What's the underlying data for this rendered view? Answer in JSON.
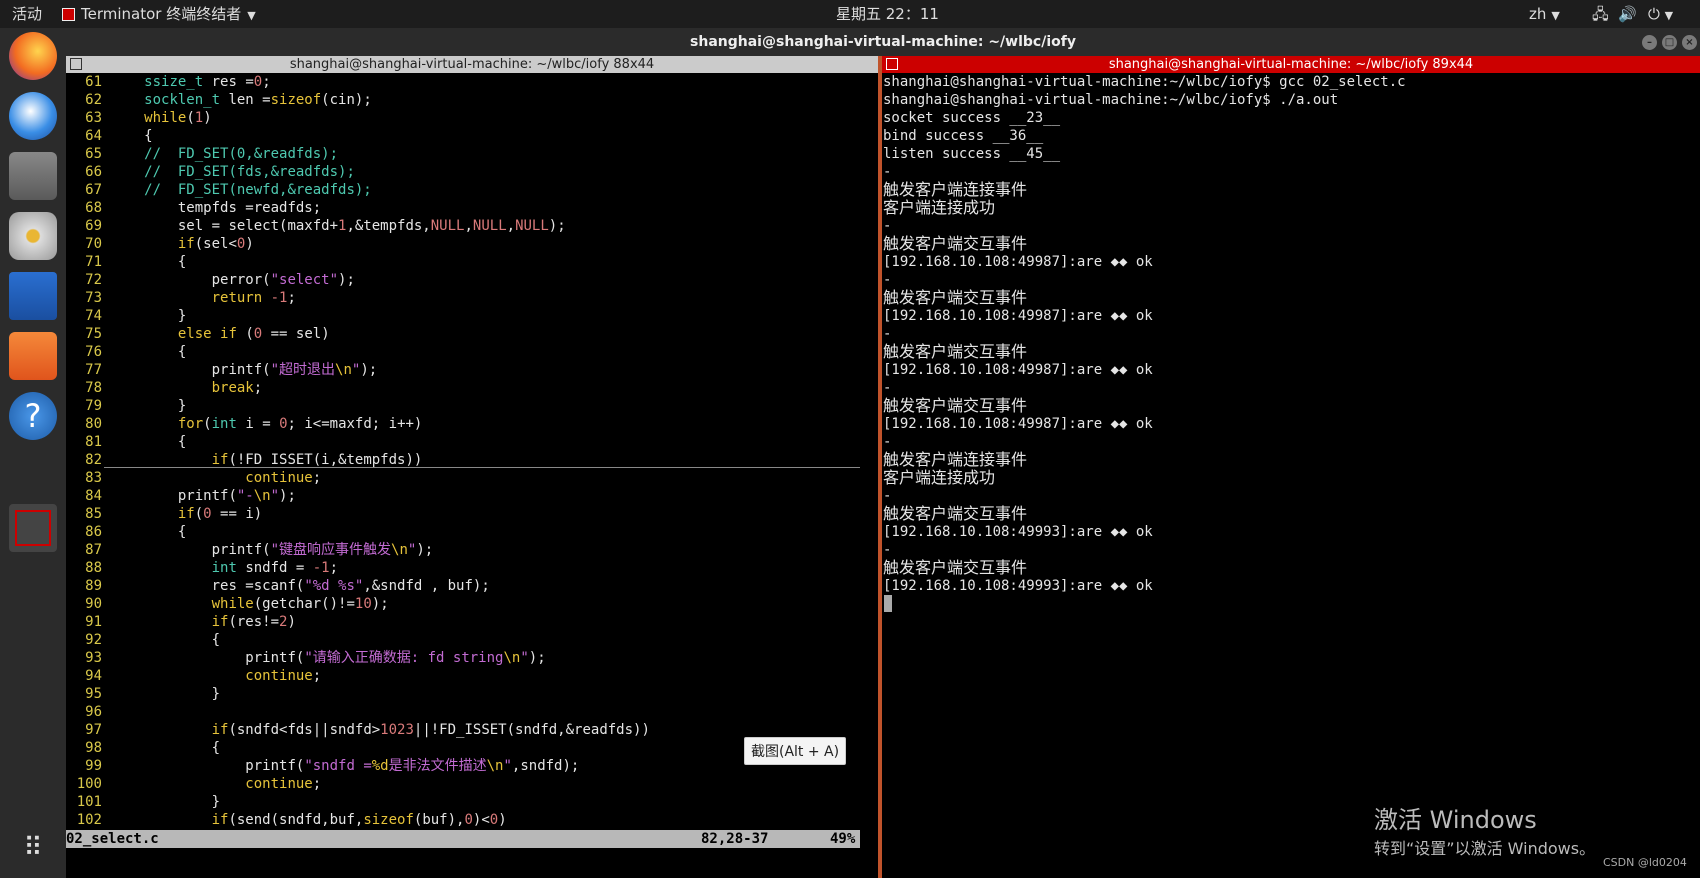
{
  "topbar": {
    "activities": "活动",
    "app_name": "Terminator 终端终结者",
    "clock": "星期五 22：11",
    "lang": "zh"
  },
  "window": {
    "title": "shanghai@shanghai-virtual-machine: ~/wlbc/iofy"
  },
  "left_pane": {
    "header": "shanghai@shanghai-virtual-machine: ~/wlbc/iofy 88x44",
    "status_file": "02_select.c",
    "status_pos": "82,28-37",
    "status_pct": "49%",
    "lines": [
      {
        "n": "61",
        "segs": [
          [
            "tx",
            "    "
          ],
          [
            "ty",
            "ssize_t"
          ],
          [
            "tx",
            " res ="
          ],
          [
            "nm",
            "0"
          ],
          [
            "tx",
            ";"
          ]
        ]
      },
      {
        "n": "62",
        "segs": [
          [
            "tx",
            "    "
          ],
          [
            "ty",
            "socklen_t"
          ],
          [
            "tx",
            " len ="
          ],
          [
            "kw",
            "sizeof"
          ],
          [
            "tx",
            "(cin);"
          ]
        ]
      },
      {
        "n": "63",
        "segs": [
          [
            "tx",
            "    "
          ],
          [
            "kw",
            "while"
          ],
          [
            "tx",
            "("
          ],
          [
            "nm",
            "1"
          ],
          [
            "tx",
            ")"
          ]
        ]
      },
      {
        "n": "64",
        "segs": [
          [
            "tx",
            "    {"
          ]
        ]
      },
      {
        "n": "65",
        "segs": [
          [
            "cm",
            "    //  FD_SET(0,&readfds);"
          ]
        ]
      },
      {
        "n": "66",
        "segs": [
          [
            "cm",
            "    //  FD_SET(fds,&readfds);"
          ]
        ]
      },
      {
        "n": "67",
        "segs": [
          [
            "cm",
            "    //  FD_SET(newfd,&readfds);"
          ]
        ]
      },
      {
        "n": "68",
        "segs": [
          [
            "tx",
            "        tempfds =readfds;"
          ]
        ]
      },
      {
        "n": "69",
        "segs": [
          [
            "tx",
            "        sel = select(maxfd+"
          ],
          [
            "nm",
            "1"
          ],
          [
            "tx",
            ",&tempfds,"
          ],
          [
            "nm",
            "NULL"
          ],
          [
            "tx",
            ","
          ],
          [
            "nm",
            "NULL"
          ],
          [
            "tx",
            ","
          ],
          [
            "nm",
            "NULL"
          ],
          [
            "tx",
            ");"
          ]
        ]
      },
      {
        "n": "70",
        "segs": [
          [
            "tx",
            "        "
          ],
          [
            "kw",
            "if"
          ],
          [
            "tx",
            "(sel<"
          ],
          [
            "nm",
            "0"
          ],
          [
            "tx",
            ")"
          ]
        ]
      },
      {
        "n": "71",
        "segs": [
          [
            "tx",
            "        {"
          ]
        ]
      },
      {
        "n": "72",
        "segs": [
          [
            "tx",
            "            perror("
          ],
          [
            "st",
            "\"select\""
          ],
          [
            "tx",
            ");"
          ]
        ]
      },
      {
        "n": "73",
        "segs": [
          [
            "tx",
            "            "
          ],
          [
            "kw",
            "return"
          ],
          [
            "tx",
            " "
          ],
          [
            "nm",
            "-1"
          ],
          [
            "tx",
            ";"
          ]
        ]
      },
      {
        "n": "74",
        "segs": [
          [
            "tx",
            "        }"
          ]
        ]
      },
      {
        "n": "75",
        "segs": [
          [
            "tx",
            "        "
          ],
          [
            "kw",
            "else if"
          ],
          [
            "tx",
            " ("
          ],
          [
            "nm",
            "0"
          ],
          [
            "tx",
            " == sel)"
          ]
        ]
      },
      {
        "n": "76",
        "segs": [
          [
            "tx",
            "        {"
          ]
        ]
      },
      {
        "n": "77",
        "segs": [
          [
            "tx",
            "            printf("
          ],
          [
            "st",
            "\"超时退出"
          ],
          [
            "es",
            "\\n"
          ],
          [
            "st",
            "\""
          ],
          [
            "tx",
            ");"
          ]
        ]
      },
      {
        "n": "78",
        "segs": [
          [
            "tx",
            "            "
          ],
          [
            "kw",
            "break"
          ],
          [
            "tx",
            ";"
          ]
        ]
      },
      {
        "n": "79",
        "segs": [
          [
            "tx",
            "        }"
          ]
        ]
      },
      {
        "n": "80",
        "segs": [
          [
            "tx",
            "        "
          ],
          [
            "kw",
            "for"
          ],
          [
            "tx",
            "("
          ],
          [
            "ty",
            "int"
          ],
          [
            "tx",
            " i = "
          ],
          [
            "nm",
            "0"
          ],
          [
            "tx",
            "; i<=maxfd; i++)"
          ]
        ]
      },
      {
        "n": "81",
        "segs": [
          [
            "tx",
            "        {"
          ]
        ]
      },
      {
        "n": "82",
        "segs": [
          [
            "tx",
            "            "
          ],
          [
            "kw",
            "if"
          ],
          [
            "tx",
            "(!FD_ISSET(i,&tempfds))"
          ]
        ]
      },
      {
        "n": "83",
        "segs": [
          [
            "tx",
            "                "
          ],
          [
            "kw",
            "continue"
          ],
          [
            "tx",
            ";"
          ]
        ]
      },
      {
        "n": "84",
        "segs": [
          [
            "tx",
            "        printf("
          ],
          [
            "st",
            "\"-"
          ],
          [
            "es",
            "\\n"
          ],
          [
            "st",
            "\""
          ],
          [
            "tx",
            ");"
          ]
        ]
      },
      {
        "n": "85",
        "segs": [
          [
            "tx",
            "        "
          ],
          [
            "kw",
            "if"
          ],
          [
            "tx",
            "("
          ],
          [
            "nm",
            "0"
          ],
          [
            "tx",
            " == i)"
          ]
        ]
      },
      {
        "n": "86",
        "segs": [
          [
            "tx",
            "        {"
          ]
        ]
      },
      {
        "n": "87",
        "segs": [
          [
            "tx",
            "            printf("
          ],
          [
            "st",
            "\"键盘响应事件触发"
          ],
          [
            "es",
            "\\n"
          ],
          [
            "st",
            "\""
          ],
          [
            "tx",
            ");"
          ]
        ]
      },
      {
        "n": "88",
        "segs": [
          [
            "tx",
            "            "
          ],
          [
            "ty",
            "int"
          ],
          [
            "tx",
            " sndfd = "
          ],
          [
            "nm",
            "-1"
          ],
          [
            "tx",
            ";"
          ]
        ]
      },
      {
        "n": "89",
        "segs": [
          [
            "tx",
            "            res =scanf("
          ],
          [
            "st",
            "\"%d %s\""
          ],
          [
            "tx",
            ",&sndfd , buf);"
          ]
        ]
      },
      {
        "n": "90",
        "segs": [
          [
            "tx",
            "            "
          ],
          [
            "kw",
            "while"
          ],
          [
            "tx",
            "(getchar()!="
          ],
          [
            "nm",
            "10"
          ],
          [
            "tx",
            ");"
          ]
        ]
      },
      {
        "n": "91",
        "segs": [
          [
            "tx",
            "            "
          ],
          [
            "kw",
            "if"
          ],
          [
            "tx",
            "(res!="
          ],
          [
            "nm",
            "2"
          ],
          [
            "tx",
            ")"
          ]
        ]
      },
      {
        "n": "92",
        "segs": [
          [
            "tx",
            "            {"
          ]
        ]
      },
      {
        "n": "93",
        "segs": [
          [
            "tx",
            "                printf("
          ],
          [
            "st",
            "\"请输入正确数据: fd string"
          ],
          [
            "es",
            "\\n"
          ],
          [
            "st",
            "\""
          ],
          [
            "tx",
            ");"
          ]
        ]
      },
      {
        "n": "94",
        "segs": [
          [
            "tx",
            "                "
          ],
          [
            "kw",
            "continue"
          ],
          [
            "tx",
            ";"
          ]
        ]
      },
      {
        "n": "95",
        "segs": [
          [
            "tx",
            "            }"
          ]
        ]
      },
      {
        "n": "96",
        "segs": [
          [
            "tx",
            ""
          ]
        ]
      },
      {
        "n": "97",
        "segs": [
          [
            "tx",
            "            "
          ],
          [
            "kw",
            "if"
          ],
          [
            "tx",
            "(sndfd<fds||sndfd>"
          ],
          [
            "nm",
            "1023"
          ],
          [
            "tx",
            "||!FD_ISSET(sndfd,&readfds))"
          ]
        ]
      },
      {
        "n": "98",
        "segs": [
          [
            "tx",
            "            {"
          ]
        ]
      },
      {
        "n": "99",
        "segs": [
          [
            "tx",
            "                printf("
          ],
          [
            "st",
            "\"sndfd ="
          ],
          [
            "es",
            "%d"
          ],
          [
            "st",
            "是非法文件描述"
          ],
          [
            "es",
            "\\n"
          ],
          [
            "st",
            "\""
          ],
          [
            "tx",
            ",sndfd);"
          ]
        ]
      },
      {
        "n": "100",
        "segs": [
          [
            "tx",
            "                "
          ],
          [
            "kw",
            "continue"
          ],
          [
            "tx",
            ";"
          ]
        ]
      },
      {
        "n": "101",
        "segs": [
          [
            "tx",
            "            }"
          ]
        ]
      },
      {
        "n": "102",
        "segs": [
          [
            "tx",
            "            "
          ],
          [
            "kw",
            "if"
          ],
          [
            "tx",
            "(send(sndfd,buf,"
          ],
          [
            "kw",
            "sizeof"
          ],
          [
            "tx",
            "(buf),"
          ],
          [
            "nm",
            "0"
          ],
          [
            "tx",
            ")<"
          ],
          [
            "nm",
            "0"
          ],
          [
            "tx",
            ")"
          ]
        ]
      }
    ]
  },
  "right_pane": {
    "header": "shanghai@shanghai-virtual-machine: ~/wlbc/iofy 89x44",
    "lines": [
      "shanghai@shanghai-virtual-machine:~/wlbc/iofy$ gcc 02_select.c",
      "shanghai@shanghai-virtual-machine:~/wlbc/iofy$ ./a.out",
      "socket success __23__",
      "bind success __36__",
      "listen success __45__",
      "-",
      "触发客户端连接事件",
      "客户端连接成功",
      "-",
      "触发客户端交互事件",
      "[192.168.10.108:49987]:are ◆◆ ok",
      "-",
      "触发客户端交互事件",
      "[192.168.10.108:49987]:are ◆◆ ok",
      "-",
      "触发客户端交互事件",
      "[192.168.10.108:49987]:are ◆◆ ok",
      "-",
      "触发客户端交互事件",
      "[192.168.10.108:49987]:are ◆◆ ok",
      "-",
      "触发客户端连接事件",
      "客户端连接成功",
      "-",
      "触发客户端交互事件",
      "[192.168.10.108:49993]:are ◆◆ ok",
      "-",
      "触发客户端交互事件",
      "[192.168.10.108:49993]:are ◆◆ ok"
    ]
  },
  "tooltip": "截图(Alt + A)",
  "watermark": {
    "line1": "激活 Windows",
    "line2": "转到“设置”以激活 Windows。"
  },
  "csdn": "CSDN @ld0204"
}
